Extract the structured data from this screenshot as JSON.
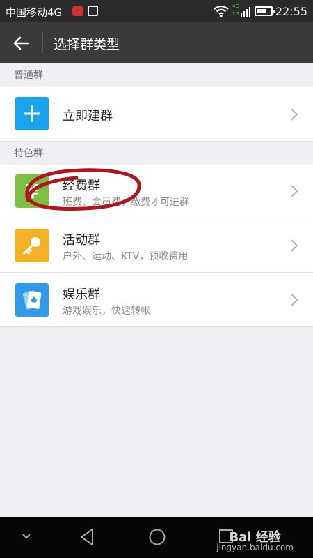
{
  "status_bar": {
    "carrier": "中国移动4G",
    "signal_labels": "4G\n2G",
    "time": "22:55"
  },
  "app_bar": {
    "back_icon": "arrow-left-icon",
    "title": "选择群类型"
  },
  "sections": [
    {
      "header": "普通群",
      "items": [
        {
          "title": "立即建群",
          "subtitle": "",
          "icon": "plus-icon",
          "icon_color": "#1aa3ef"
        }
      ]
    },
    {
      "header": "特色群",
      "items": [
        {
          "title": "经费群",
          "subtitle": "班费、会员费，缴费才可进群",
          "icon": "yen-icon",
          "icon_color": "#7bc043"
        },
        {
          "title": "活动群",
          "subtitle": "户外、运动、KTV，预收费用",
          "icon": "key-icon",
          "icon_color": "#f6b026"
        },
        {
          "title": "娱乐群",
          "subtitle": "游戏娱乐，快速转帐",
          "icon": "playing-card-icon",
          "icon_color": "#2f9ae8"
        }
      ]
    }
  ],
  "annotation": {
    "color": "#b0161b"
  },
  "nav_bar": {
    "items": [
      "collapse-icon",
      "back-triangle-icon",
      "home-circle-icon",
      "recents-square-icon"
    ]
  },
  "watermark": {
    "brand": "Bai 经验",
    "url": "jingyan.baidu.com"
  }
}
